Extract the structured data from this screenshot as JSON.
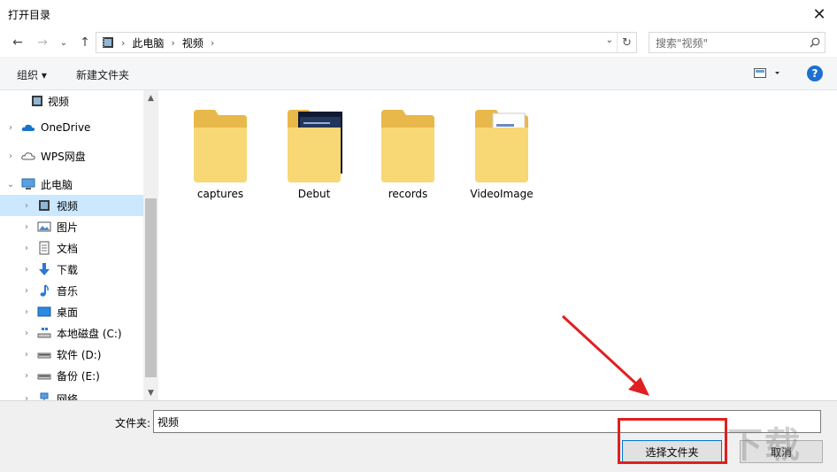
{
  "window": {
    "title": "打开目录",
    "close_glyph": "✕"
  },
  "nav": {
    "back": "←",
    "forward": "→",
    "recent": "⌄",
    "up": "↑",
    "breadcrumb": [
      "此电脑",
      "视频"
    ],
    "refresh": "↻",
    "search_placeholder": "搜索\"视频\""
  },
  "toolbar": {
    "organize": "组织 ▾",
    "new_folder": "新建文件夹",
    "help": "?"
  },
  "tree": [
    {
      "label": "视频",
      "icon": "video-library-icon",
      "expanded": false
    },
    {
      "label": "OneDrive",
      "icon": "onedrive-icon"
    },
    {
      "label": "WPS网盘",
      "icon": "wps-cloud-icon"
    },
    {
      "label": "此电脑",
      "icon": "this-pc-icon"
    },
    {
      "label": "视频",
      "icon": "video-library-icon"
    },
    {
      "label": "图片",
      "icon": "pictures-icon"
    },
    {
      "label": "文档",
      "icon": "documents-icon"
    },
    {
      "label": "下载",
      "icon": "downloads-icon"
    },
    {
      "label": "音乐",
      "icon": "music-icon"
    },
    {
      "label": "桌面",
      "icon": "desktop-icon"
    },
    {
      "label": "本地磁盘 (C:)",
      "icon": "system-drive-icon"
    },
    {
      "label": "软件 (D:)",
      "icon": "drive-icon"
    },
    {
      "label": "备份 (E:)",
      "icon": "drive-icon"
    },
    {
      "label": "网络",
      "icon": "network-icon"
    }
  ],
  "folders": [
    {
      "name": "captures",
      "type": "plain"
    },
    {
      "name": "Debut",
      "type": "preview-app"
    },
    {
      "name": "records",
      "type": "plain"
    },
    {
      "name": "VideoImage",
      "type": "preview-doc"
    }
  ],
  "bottom": {
    "folder_label": "文件夹:",
    "folder_value": "视频",
    "select_button": "选择文件夹",
    "cancel_button": "取消"
  },
  "colors": {
    "accent": "#0078d7",
    "selection": "#cce8ff",
    "annotation": "#e02020",
    "folder": "#f8d775"
  }
}
